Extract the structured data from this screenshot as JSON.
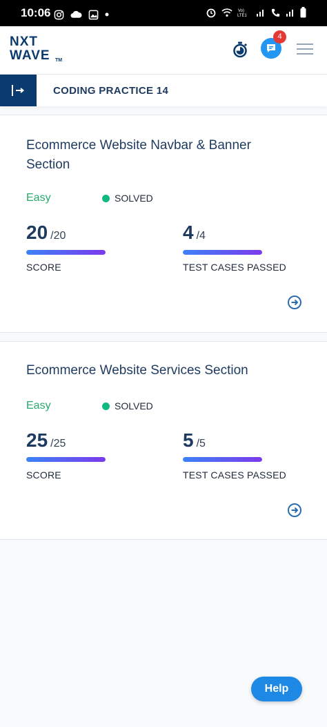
{
  "status_bar": {
    "time": "10:06",
    "left_icons": [
      "instagram-icon",
      "cloud-icon",
      "gallery-icon",
      "dot-icon"
    ],
    "right_icons": [
      "alarm-icon",
      "wifi-icon",
      "volte-icon",
      "signal-icon",
      "call-icon",
      "signal-icon",
      "battery-icon"
    ]
  },
  "header": {
    "logo_line1": "NXT",
    "logo_line2": "WAVE",
    "logo_tm": "TM",
    "notification_count": "4"
  },
  "practice": {
    "title": "CODING PRACTICE 14"
  },
  "problems": [
    {
      "title": "Ecommerce Website Navbar & Banner Section",
      "difficulty": "Easy",
      "status": "SOLVED",
      "score": "20",
      "score_total": "/20",
      "score_label": "SCORE",
      "score_fraction": 1.0,
      "tests": "4",
      "tests_total": "/4",
      "tests_label": "TEST CASES PASSED",
      "tests_fraction": 1.0
    },
    {
      "title": "Ecommerce Website Services Section",
      "difficulty": "Easy",
      "status": "SOLVED",
      "score": "25",
      "score_total": "/25",
      "score_label": "SCORE",
      "score_fraction": 1.0,
      "tests": "5",
      "tests_total": "/5",
      "tests_label": "TEST CASES PASSED",
      "tests_fraction": 1.0
    }
  ],
  "help_button": "Help",
  "colors": {
    "brand_navy": "#0b3b6e",
    "easy_green": "#26a96c",
    "solved_dot": "#10b981",
    "progress_start": "#3b82f6",
    "progress_end": "#7c3aed",
    "help_blue": "#1e88e5",
    "badge_red": "#e53935"
  }
}
